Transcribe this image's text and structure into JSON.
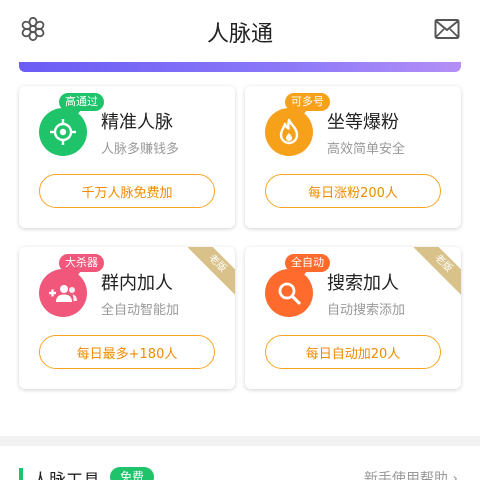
{
  "header": {
    "title": "人脉通",
    "left_icon": "flower-settings-icon",
    "right_icon": "mail-icon"
  },
  "cards": [
    {
      "badge": "高通过",
      "title": "精准人脉",
      "subtitle": "人脉多赚钱多",
      "button": "千万人脉免费加",
      "icon": "target-icon",
      "color": "#1fc36a"
    },
    {
      "badge": "可多号",
      "title": "坐等爆粉",
      "subtitle": "高效简单安全",
      "button": "每日涨粉200人",
      "icon": "flame-icon",
      "color": "#f7a11a"
    },
    {
      "badge": "大杀器",
      "title": "群内加人",
      "subtitle": "全自动智能加",
      "button": "每日最多+180人",
      "icon": "group-add-icon",
      "color": "#f0577a",
      "ribbon": "老版"
    },
    {
      "badge": "全自动",
      "title": "搜索加人",
      "subtitle": "自动搜索添加",
      "button": "每日自动加20人",
      "icon": "search-icon",
      "color": "#ff6a2d",
      "ribbon": "老版"
    }
  ],
  "section": {
    "title": "人脉工具",
    "free_badge": "免费",
    "help_link": "新手使用帮助",
    "help_chevron": "›"
  },
  "colors": {
    "accent_orange": "#f5a623",
    "green": "#1fc36a"
  }
}
